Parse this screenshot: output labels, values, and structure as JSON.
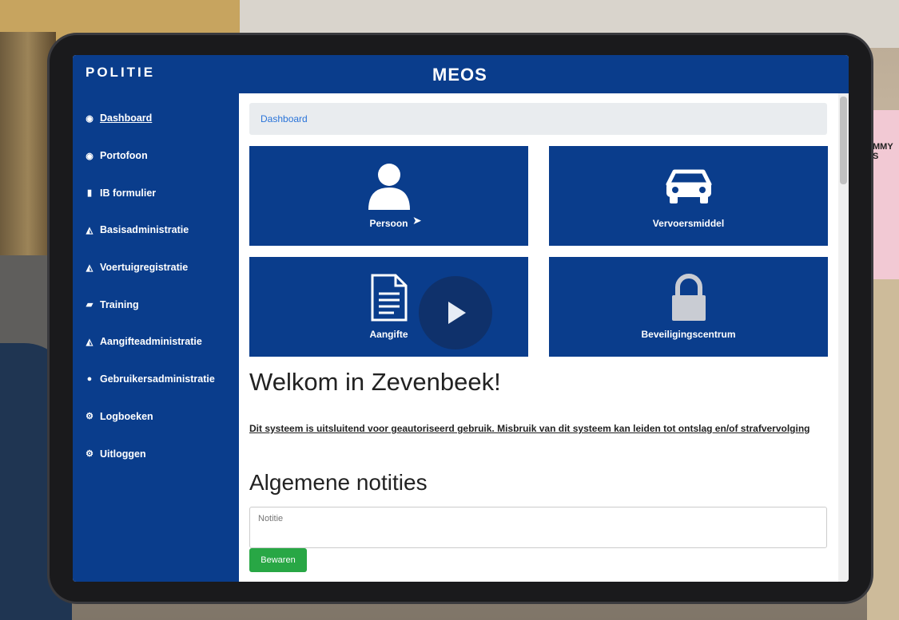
{
  "app": {
    "logo": "POLITIE",
    "title": "MEOS"
  },
  "sidebar": {
    "items": [
      {
        "label": "Dashboard",
        "icon": "dashboard-icon",
        "active": true
      },
      {
        "label": "Portofoon",
        "icon": "dashboard-icon"
      },
      {
        "label": "IB formulier",
        "icon": "file-icon"
      },
      {
        "label": "Basisadministratie",
        "icon": "area-chart-icon"
      },
      {
        "label": "Voertuigregistratie",
        "icon": "area-chart-icon"
      },
      {
        "label": "Training",
        "icon": "book-icon"
      },
      {
        "label": "Aangifteadministratie",
        "icon": "area-chart-icon"
      },
      {
        "label": "Gebruikersadministratie",
        "icon": "user-icon"
      },
      {
        "label": "Logboeken",
        "icon": "cogs-icon"
      },
      {
        "label": "Uitloggen",
        "icon": "cogs-icon"
      }
    ]
  },
  "breadcrumb": "Dashboard",
  "tiles": [
    {
      "label": "Persoon",
      "icon": "person-icon"
    },
    {
      "label": "Vervoersmiddel",
      "icon": "car-icon"
    },
    {
      "label": "Aangifte",
      "icon": "document-icon"
    },
    {
      "label": "Beveiligingscentrum",
      "icon": "lock-icon"
    }
  ],
  "welcome": "Welkom in Zevenbeek!",
  "notice": "Dit systeem is uitsluitend voor geautoriseerd gebruik. Misbruik van dit systeem kan leiden tot ontslag en/of strafvervolging",
  "notes": {
    "title": "Algemene notities",
    "placeholder": "Notitie",
    "save_label": "Bewaren"
  },
  "colors": {
    "primary": "#0a3d8c",
    "success": "#28a745",
    "breadcrumb_bg": "#e9ecef",
    "link": "#2a74d9"
  },
  "background_card": {
    "lines": [
      "MMY S"
    ]
  }
}
